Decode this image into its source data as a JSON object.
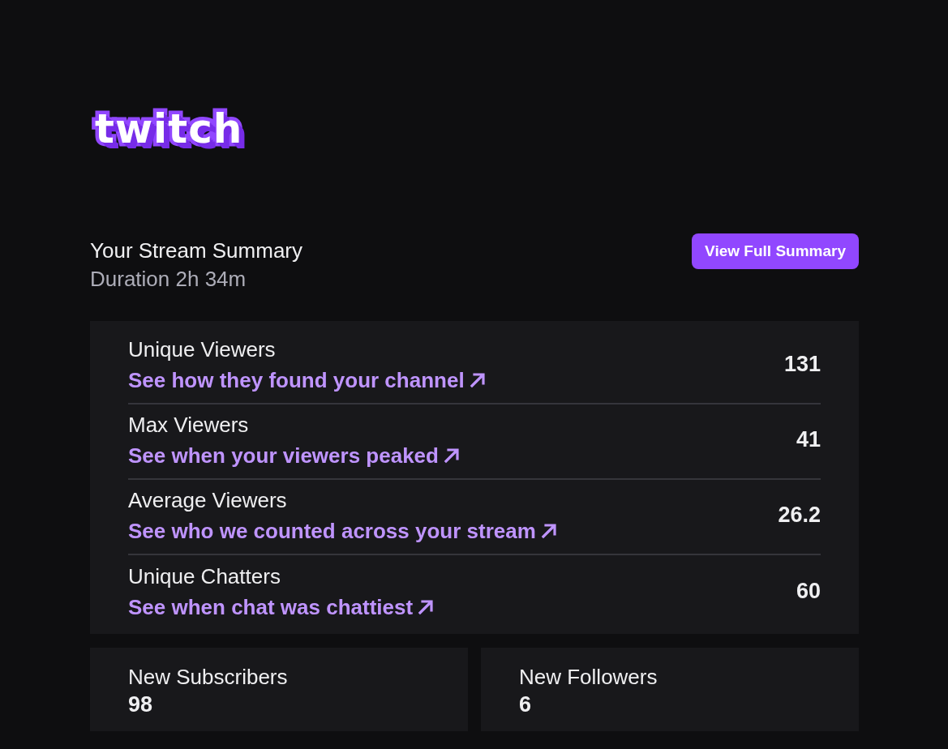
{
  "logo": {
    "text": "twitch"
  },
  "summary": {
    "title": "Your Stream Summary",
    "duration": "Duration 2h 34m",
    "button": "View Full Summary"
  },
  "metrics": [
    {
      "label": "Unique Viewers",
      "link": "See how they found your channel",
      "value": "131"
    },
    {
      "label": "Max Viewers",
      "link": "See when your viewers peaked",
      "value": "41"
    },
    {
      "label": "Average Viewers",
      "link": "See who we counted across your stream",
      "value": "26.2"
    },
    {
      "label": "Unique Chatters",
      "link": "See when chat was chattiest",
      "value": "60"
    }
  ],
  "totals": [
    {
      "label": "New Subscribers",
      "value": "98"
    },
    {
      "label": "New Followers",
      "value": "6"
    }
  ]
}
